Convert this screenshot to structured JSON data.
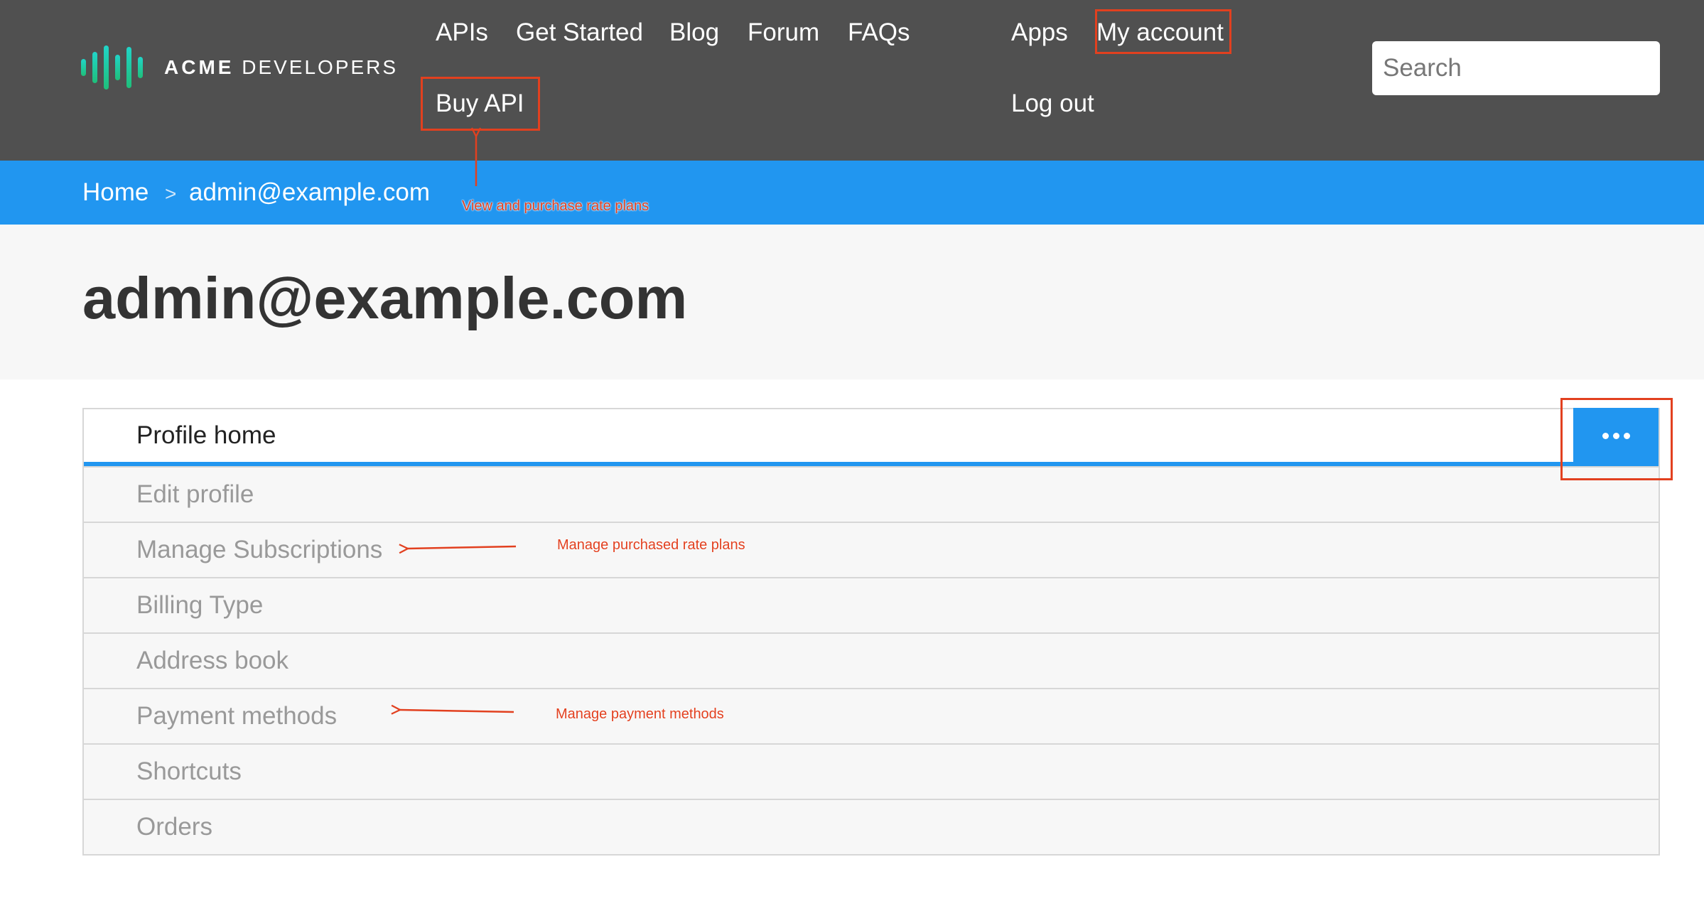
{
  "brand": {
    "bold": "ACME",
    "rest": "DEVELOPERS"
  },
  "nav": {
    "apis": "APIs",
    "get_started": "Get Started",
    "blog": "Blog",
    "forum": "Forum",
    "faqs": "FAQs",
    "buy_api": "Buy API",
    "apps": "Apps",
    "my_account": "My account",
    "log_out": "Log out"
  },
  "search": {
    "placeholder": "Search"
  },
  "breadcrumb": {
    "home": "Home",
    "separator": ">",
    "current": "admin@example.com"
  },
  "page_title": "admin@example.com",
  "tabs": [
    {
      "label": "Profile home",
      "active": true
    },
    {
      "label": "Edit profile"
    },
    {
      "label": "Manage Subscriptions"
    },
    {
      "label": "Billing Type"
    },
    {
      "label": "Address book"
    },
    {
      "label": "Payment methods"
    },
    {
      "label": "Shortcuts"
    },
    {
      "label": "Orders"
    }
  ],
  "annotations": {
    "buy_api": "View and purchase rate plans",
    "subscriptions": "Manage purchased rate plans",
    "payment": "Manage payment methods"
  },
  "colors": {
    "header": "#505050",
    "accent": "#2196f0",
    "annotation": "#e2401f",
    "logo_gradient": [
      "#21d4c8",
      "#1fbf7a"
    ]
  }
}
